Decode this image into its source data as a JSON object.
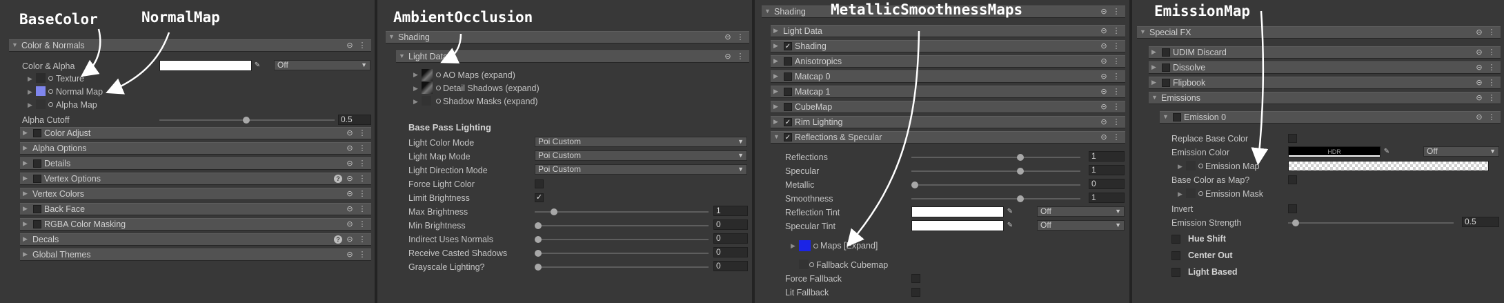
{
  "annotations": {
    "base_color": "BaseColor",
    "normal_map": "NormalMap",
    "ambient_occlusion": "AmbientOcclusion",
    "metallic_smoothness": "MetallicSmoothnessMaps",
    "emission_map": "EmissionMap"
  },
  "panel1": {
    "header": "Color & Normals",
    "color_alpha_label": "Color & Alpha",
    "color_alpha_dropdown": "Off",
    "texture_label": "Texture",
    "normal_map_label": "Normal Map",
    "alpha_map_label": "Alpha Map",
    "alpha_cutoff_label": "Alpha Cutoff",
    "alpha_cutoff_value": "0.5",
    "sections": [
      "Color Adjust",
      "Alpha Options",
      "Details",
      "Vertex Options",
      "Vertex Colors",
      "Back Face",
      "RGBA Color Masking",
      "Decals",
      "Global Themes"
    ]
  },
  "panel2": {
    "header": "Shading",
    "light_data": "Light Data",
    "ao_maps": "AO Maps (expand)",
    "detail_shadows": "Detail Shadows (expand)",
    "shadow_masks": "Shadow Masks (expand)",
    "base_pass_title": "Base Pass Lighting",
    "light_color_mode": "Light Color Mode",
    "light_color_mode_value": "Poi Custom",
    "light_map_mode": "Light Map Mode",
    "light_map_mode_value": "Poi Custom",
    "light_direction_mode": "Light Direction Mode",
    "light_direction_mode_value": "Poi Custom",
    "force_light_color": "Force Light Color",
    "limit_brightness": "Limit Brightness",
    "max_brightness": "Max Brightness",
    "max_brightness_value": "1",
    "min_brightness": "Min Brightness",
    "min_brightness_value": "0",
    "indirect_uses_normals": "Indirect Uses Normals",
    "indirect_uses_normals_value": "0",
    "receive_casted_shadows": "Receive Casted Shadows",
    "receive_casted_shadows_value": "0",
    "grayscale_lighting": "Grayscale Lighting?",
    "grayscale_lighting_value": "0"
  },
  "panel3": {
    "header": "Shading",
    "sections": [
      "Light Data",
      "Shading",
      "Anisotropics",
      "Matcap 0",
      "Matcap 1",
      "CubeMap",
      "Rim Lighting",
      "Reflections & Specular"
    ],
    "reflections": "Reflections",
    "reflections_value": "1",
    "specular": "Specular",
    "specular_value": "1",
    "metallic": "Metallic",
    "metallic_value": "0",
    "smoothness": "Smoothness",
    "smoothness_value": "1",
    "reflection_tint": "Reflection Tint",
    "reflection_tint_dropdown": "Off",
    "specular_tint": "Specular Tint",
    "specular_tint_dropdown": "Off",
    "maps_expand": "Maps [Expand]",
    "fallback_cubemap": "Fallback Cubemap",
    "force_fallback": "Force Fallback",
    "lit_fallback": "Lit Fallback"
  },
  "panel4": {
    "header": "Special FX",
    "sections": [
      "UDIM Discard",
      "Dissolve",
      "Flipbook",
      "Emissions"
    ],
    "emission0": "Emission 0",
    "replace_base_color": "Replace Base Color",
    "emission_color": "Emission Color",
    "emission_color_hdr": "HDR",
    "emission_color_dropdown": "Off",
    "emission_map": "Emission Map",
    "base_color_as_map": "Base Color as Map?",
    "emission_mask": "Emission Mask",
    "invert": "Invert",
    "emission_strength": "Emission Strength",
    "emission_strength_value": "0.5",
    "hue_shift": "Hue Shift",
    "center_out": "Center Out",
    "light_based": "Light Based"
  },
  "colors": {
    "accent_normal": "#7f86ee",
    "accent_maps": "#1b24e6",
    "bg": "#383838"
  }
}
